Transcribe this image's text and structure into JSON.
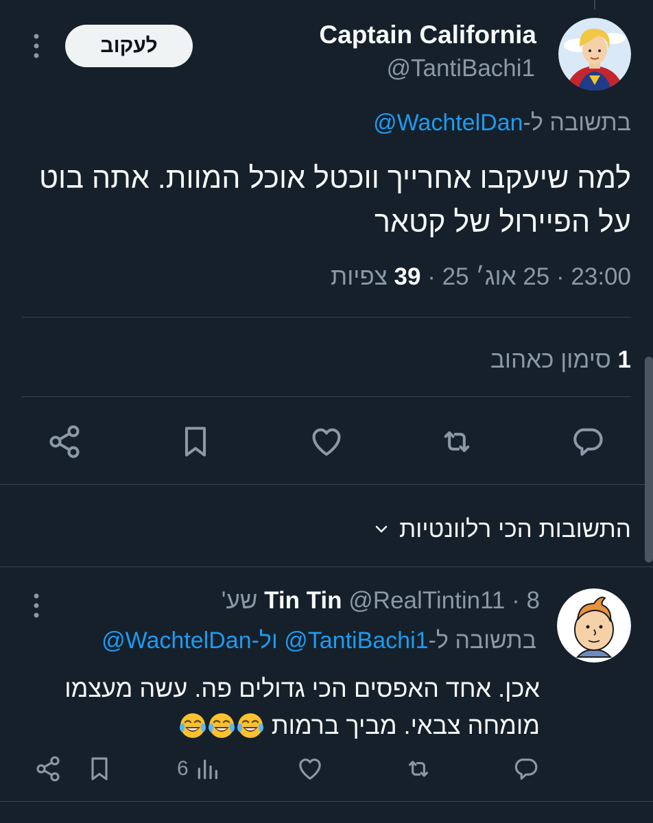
{
  "main_tweet": {
    "display_name": "Captain California",
    "handle": "@TantiBachi1",
    "follow_label": "לעקוב",
    "reply_to_prefix": "בתשובה ל-",
    "reply_to_handle": "@WachtelDan",
    "text": "למה שיעקבו אחרייך ווכטל אוכל המוות. אתה בוט על הפיירול של קטאר",
    "time": "23:00",
    "date": "25 אוג׳ 25",
    "views_count": "39",
    "views_label": "צפיות",
    "separator": "·",
    "likes_count": "1",
    "likes_label": "סימון כאהוב"
  },
  "replies_sort": {
    "label": "התשובות הכי רלוונטיות"
  },
  "reply": {
    "display_name": "Tin Tin",
    "handle": "@RealTintin11",
    "time_ago": "8 שע'",
    "separator": "·",
    "reply_to_prefix": "בתשובה ל-",
    "reply_to_handle_1": "@TantiBachi1",
    "reply_to_connector": "ול-",
    "reply_to_handle_2": "@WachtelDan",
    "text": "אכן. אחד האפסים הכי גדולים פה. עשה מעצמו מומחה צבאי. מביך ברמות",
    "emojis": [
      "face-with-tears-of-joy",
      "face-with-tears-of-joy",
      "face-with-tears-of-joy"
    ],
    "views_count": "6"
  },
  "colors": {
    "background": "#15202b",
    "text": "#f7f9f9",
    "muted": "#8b98a5",
    "link": "#1d9bf0",
    "divider": "#38444d"
  },
  "icons": {
    "main_actions": [
      "share-icon",
      "bookmark-icon",
      "like-icon",
      "retweet-icon",
      "reply-icon"
    ],
    "reply_actions": [
      "share-icon",
      "bookmark-icon",
      "views-icon",
      "like-icon",
      "retweet-icon",
      "reply-icon"
    ]
  }
}
